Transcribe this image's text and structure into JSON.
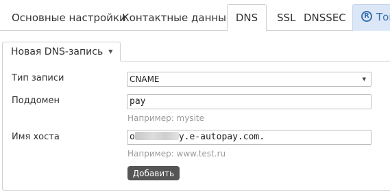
{
  "tabs": {
    "basic_settings": "Основные настройки",
    "contact_data": "Контактные данные",
    "dns": "DNS",
    "ssl": "SSL",
    "dnssec": "DNSSEC",
    "special_label": "Тов",
    "special_icon_char": "R"
  },
  "form": {
    "panel_title": "Новая DNS-запись",
    "type_label": "Тип записи",
    "type_value": "CNAME",
    "subdomain_label": "Поддомен",
    "subdomain_value": "pay",
    "subdomain_hint": "Например: mysite",
    "host_label": "Имя хоста",
    "host_value_prefix": "o",
    "host_value_suffix": "y.e-autopay.com.",
    "host_hint": "Например: www.test.ru",
    "add_button": "Добавить"
  },
  "colors": {
    "accent_tab_bg": "#dbe7f6",
    "accent_tab_text": "#3a6fb0",
    "button_bg": "#555555"
  }
}
